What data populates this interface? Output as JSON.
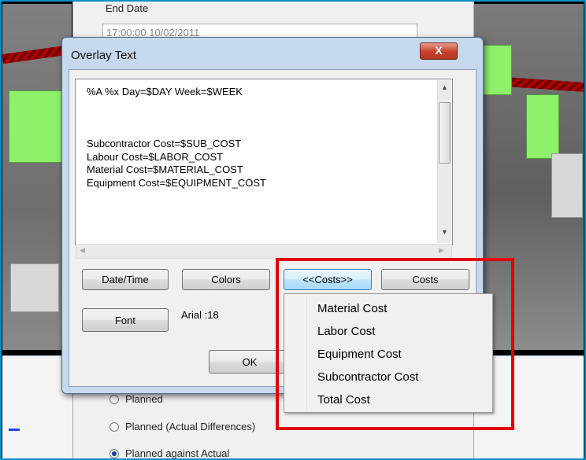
{
  "background_dialog": {
    "end_date_label": "End Date",
    "end_date_value": "17:00:00 10/02/2011",
    "radio_options": [
      {
        "label": "Planned",
        "selected": false
      },
      {
        "label": "Planned (Actual Differences)",
        "selected": false
      },
      {
        "label": "Planned against Actual",
        "selected": true
      }
    ]
  },
  "dialog": {
    "title": "Overlay Text",
    "close_glyph": "X",
    "text_lines": [
      "%A %x Day=$DAY Week=$WEEK",
      "",
      "",
      "",
      "Subcontractor Cost=$SUB_COST",
      "Labour Cost=$LABOR_COST",
      "Material Cost=$MATERIAL_COST",
      "Equipment Cost=$EQUIPMENT_COST"
    ],
    "buttons": {
      "date_time": "Date/Time",
      "colors": "Colors",
      "costs_toggle": "<<Costs>>",
      "costs": "Costs",
      "font": "Font",
      "ok": "OK"
    },
    "font_value": "Arial :18"
  },
  "costs_menu": {
    "items": [
      "Material Cost",
      "Labor Cost",
      "Equipment Cost",
      "Subcontractor Cost",
      "Total Cost"
    ]
  },
  "colors": {
    "highlight": "#e00000",
    "close_button": "#c7412a",
    "frame_accent": "#0b90c8"
  }
}
